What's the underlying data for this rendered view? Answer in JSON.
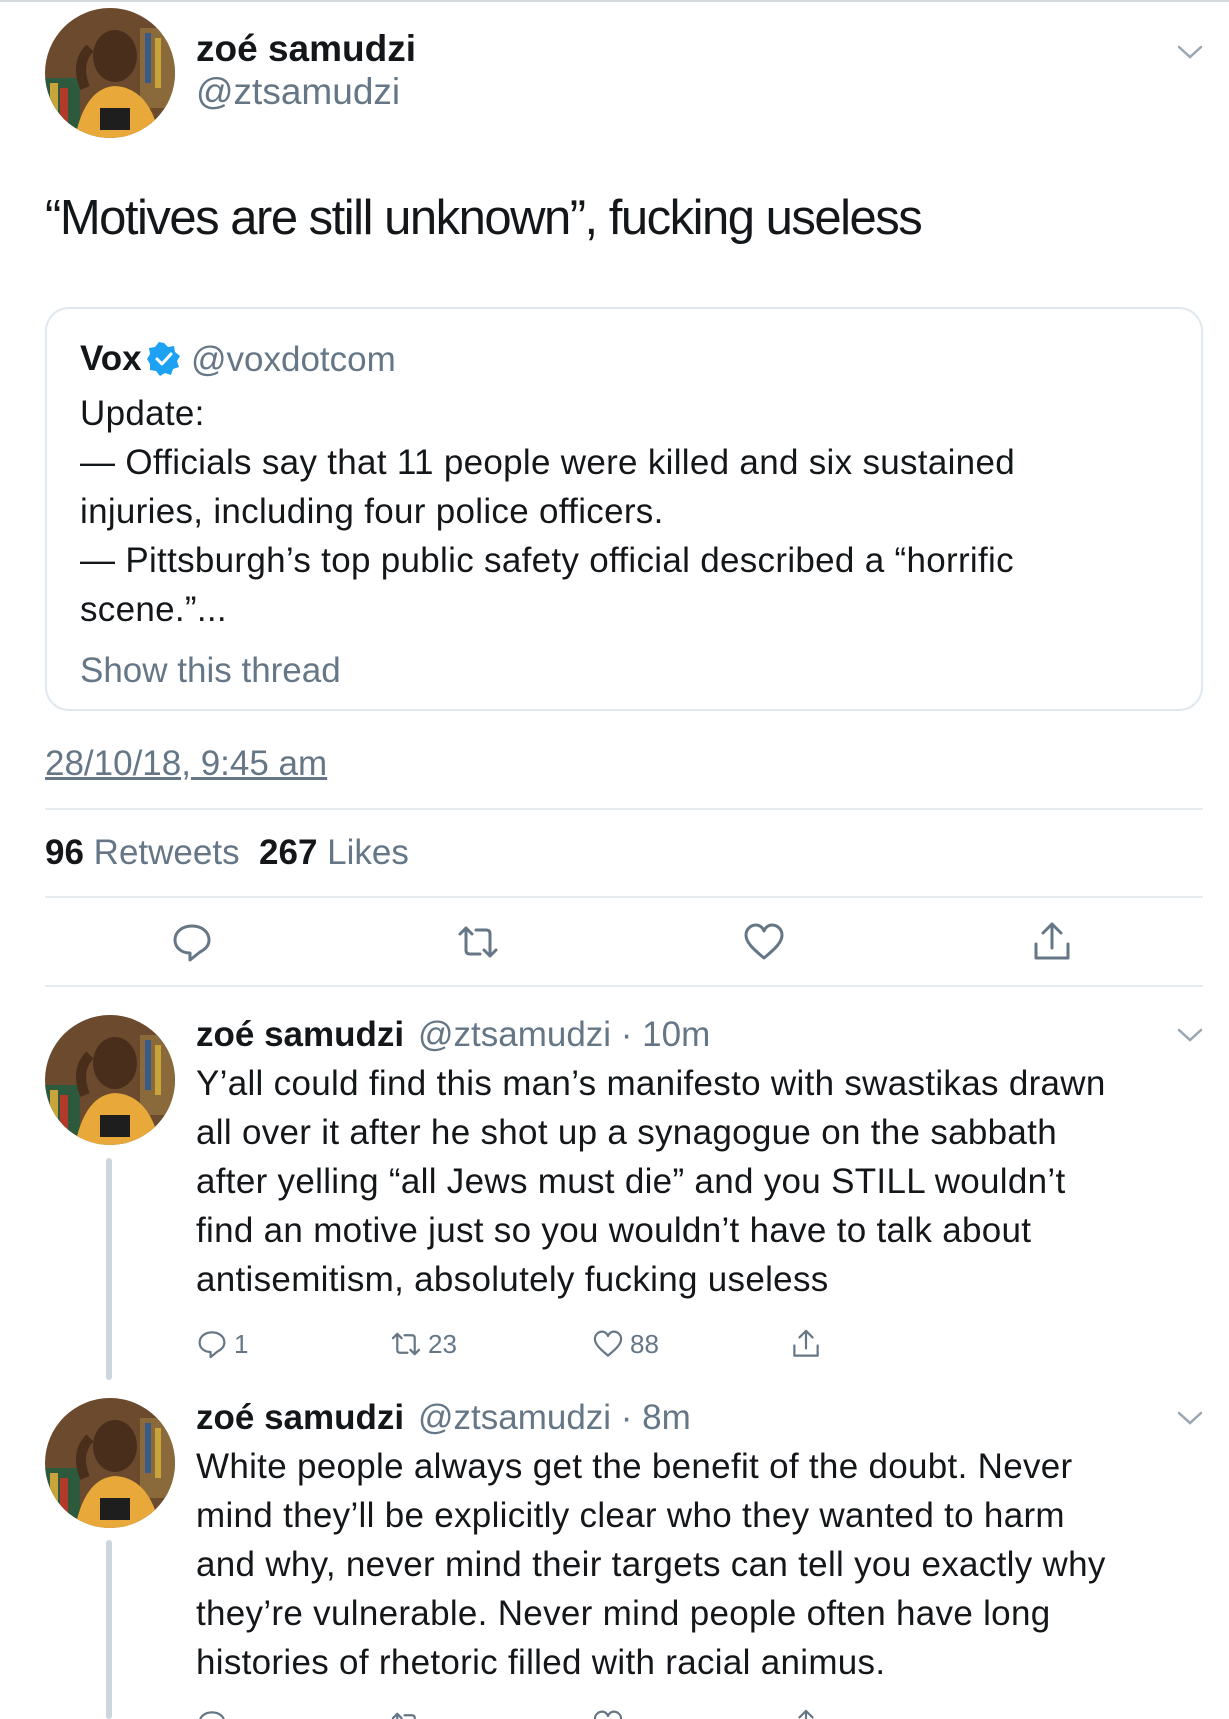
{
  "main_tweet": {
    "author_name": "zoé samudzi",
    "author_handle": "@ztsamudzi",
    "text": "“Motives are still unknown”, fucking useless",
    "quoted": {
      "name": "Vox",
      "handle": "@voxdotcom",
      "lines": [
        "Update:",
        "— Officials say that 11 people were killed and six sustained",
        "injuries, including four police officers.",
        "— Pittsburgh’s top public safety official described a “horrific",
        "scene.”..."
      ],
      "show_thread": "Show this thread"
    },
    "timestamp": "28/10/18, 9:45 am",
    "retweets_count": "96",
    "retweets_label": "Retweets",
    "likes_count": "267",
    "likes_label": "Likes"
  },
  "replies": [
    {
      "author_name": "zoé samudzi",
      "meta": "@ztsamudzi · 10m",
      "lines": [
        "Y’all could find this man’s manifesto with swastikas drawn",
        "all over it after he shot up a synagogue on the sabbath",
        "after yelling “all Jews must die” and you STILL wouldn’t",
        "find an motive just so you wouldn’t have to talk about",
        "antisemitism, absolutely fucking useless"
      ],
      "reply_count": "1",
      "retweet_count": "23",
      "like_count": "88"
    },
    {
      "author_name": "zoé samudzi",
      "meta": "@ztsamudzi · 8m",
      "lines": [
        "White people always get the benefit of the doubt. Never",
        "mind they’ll be explicitly clear who they wanted to harm",
        "and why, never mind their targets can tell you exactly why",
        "they’re vulnerable. Never mind people often have long",
        "histories of rhetoric filled with racial animus."
      ],
      "reply_count": "",
      "retweet_count": "",
      "like_count": ""
    }
  ],
  "icons": {
    "reply": "reply-icon",
    "retweet": "retweet-icon",
    "like": "heart-icon",
    "share": "share-icon",
    "verified": "verified-badge-icon",
    "menu": "chevron-down-icon"
  },
  "colors": {
    "text": "#14171a",
    "secondary": "#657786",
    "border": "#e1e8ed",
    "verified": "#1da1f2"
  }
}
